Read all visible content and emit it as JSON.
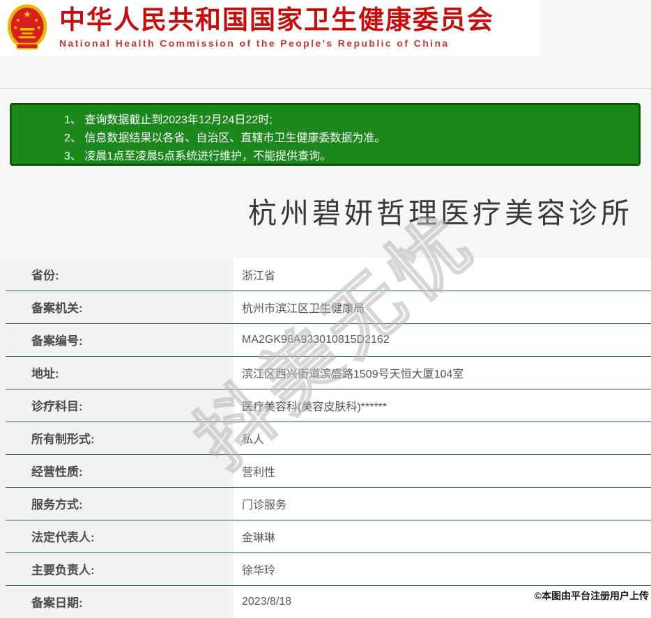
{
  "header": {
    "title_cn": "中华人民共和国国家卫生健康委员会",
    "title_en": "National Health Commission of the People's Republic of China",
    "emblem_icon": "china-national-emblem-icon"
  },
  "notice": {
    "items": [
      "1、 查询数据截止到2023年12月24日22时;",
      "2、 信息数据结果以各省、自治区、直辖市卫生健康委数据为准。",
      "3、 凌晨1点至凌晨5点系统进行维护，不能提供查询。"
    ]
  },
  "institution": {
    "name": "杭州碧妍哲理医疗美容诊所"
  },
  "details": {
    "rows": [
      {
        "label": "省份:",
        "value": "浙江省"
      },
      {
        "label": "备案机关:",
        "value": "杭州市滨江区卫生健康局"
      },
      {
        "label": "备案编号:",
        "value": "MA2GK96A933010815D2162"
      },
      {
        "label": "地址:",
        "value": "滨江区西兴街道滨盛路1509号天恒大厦104室"
      },
      {
        "label": "诊疗科目:",
        "value": "医疗美容科(美容皮肤科)******"
      },
      {
        "label": "所有制形式:",
        "value": "私人"
      },
      {
        "label": "经营性质:",
        "value": "营利性"
      },
      {
        "label": "服务方式:",
        "value": "门诊服务"
      },
      {
        "label": "法定代表人:",
        "value": "金琳琳"
      },
      {
        "label": "主要负责人:",
        "value": "徐华玲"
      },
      {
        "label": "备案日期:",
        "value": "2023/8/18"
      }
    ]
  },
  "watermark": {
    "text": "抖美无忧"
  },
  "attribution": {
    "text": "©本图由平台注册用户上传"
  },
  "colors": {
    "page-bg": "#f5f6f5",
    "brand-red": "#c40d0d",
    "brand-red-light": "#c73535",
    "notice-green": "#1c871c",
    "notice-border-green": "#0a5a0a",
    "row-divider-teal": "#2a5d51",
    "label-gray-bg": "#f2f2f2"
  }
}
